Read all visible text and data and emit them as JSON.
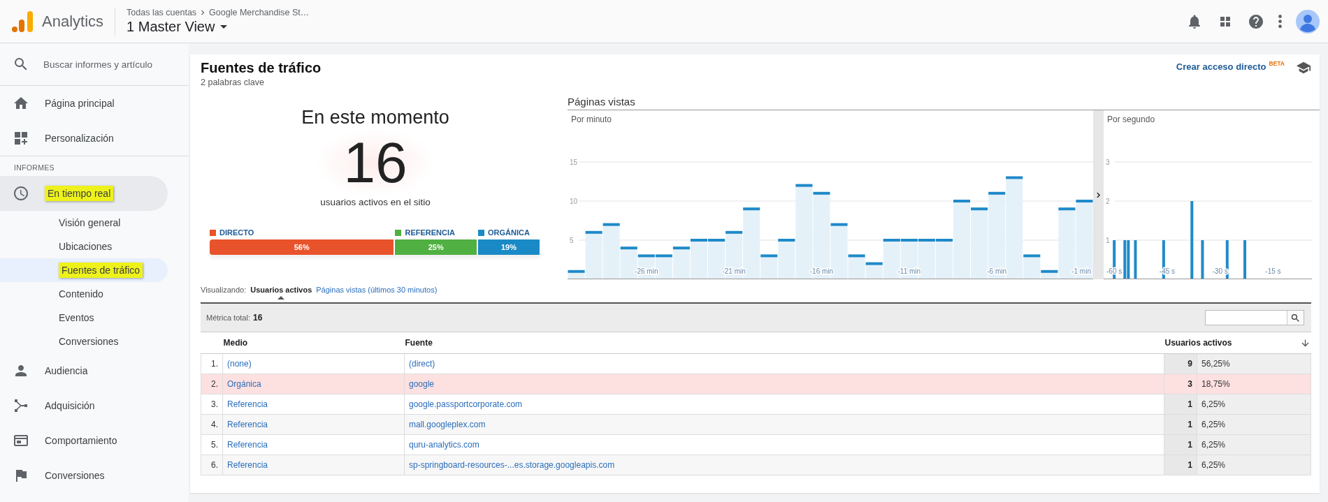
{
  "header": {
    "product": "Analytics",
    "breadcrumb": [
      "Todas las cuentas",
      "Google Merchandise St…"
    ],
    "view": "1 Master View"
  },
  "sidebar": {
    "search_placeholder": "Buscar informes y artículo",
    "nav": [
      {
        "label": "Página principal"
      },
      {
        "label": "Personalización"
      }
    ],
    "section_label": "INFORMES",
    "reports": [
      {
        "label": "En tiempo real",
        "selected": true,
        "highlighted": true,
        "children": [
          {
            "label": "Visión general",
            "selected": false,
            "highlighted": false
          },
          {
            "label": "Ubicaciones",
            "selected": false,
            "highlighted": false
          },
          {
            "label": "Fuentes de tráfico",
            "selected": true,
            "highlighted": true
          },
          {
            "label": "Contenido",
            "selected": false,
            "highlighted": false
          },
          {
            "label": "Eventos",
            "selected": false,
            "highlighted": false
          },
          {
            "label": "Conversiones",
            "selected": false,
            "highlighted": false
          }
        ]
      },
      {
        "label": "Audiencia",
        "selected": false,
        "highlighted": false
      },
      {
        "label": "Adquisición",
        "selected": false,
        "highlighted": false
      },
      {
        "label": "Comportamiento",
        "selected": false,
        "highlighted": false
      },
      {
        "label": "Conversiones",
        "selected": false,
        "highlighted": false
      }
    ]
  },
  "report": {
    "title": "Fuentes de tráfico",
    "subtitle": "2 palabras clave",
    "shortcut_link": "Crear acceso directo",
    "shortcut_badge": "BETA",
    "now": {
      "heading": "En este momento",
      "count": "16",
      "caption": "usuarios activos en el sitio",
      "segments": [
        {
          "label": "DIRECTO",
          "value": "56%",
          "color": "#e9532b"
        },
        {
          "label": "REFERENCIA",
          "value": "25%",
          "color": "#50b041"
        },
        {
          "label": "ORGÁNICA",
          "value": "19%",
          "color": "#1a8ac6"
        }
      ]
    },
    "pageviews": {
      "title": "Páginas vistas",
      "per_minute": {
        "label": "Por minuto",
        "chart_data": {
          "type": "bar",
          "x": [
            -30,
            -29,
            -28,
            -27,
            -26,
            -25,
            -24,
            -23,
            -22,
            -21,
            -20,
            -19,
            -18,
            -17,
            -16,
            -15,
            -14,
            -13,
            -12,
            -11,
            -10,
            -9,
            -8,
            -7,
            -6,
            -5,
            -4,
            -3,
            -2,
            -1
          ],
          "values": [
            1,
            6,
            7,
            4,
            3,
            3,
            4,
            5,
            5,
            6,
            9,
            3,
            5,
            12,
            11,
            7,
            3,
            2,
            5,
            5,
            5,
            5,
            10,
            9,
            11,
            13,
            3,
            1,
            9,
            10
          ],
          "xlim": [
            -30.5,
            -0.5
          ],
          "ylim": [
            0,
            15
          ],
          "grid": true,
          "xticks": [
            {
              "value": -26,
              "label": "-26 min"
            },
            {
              "value": -21,
              "label": "-21 min"
            },
            {
              "value": -16,
              "label": "-16 min"
            },
            {
              "value": -11,
              "label": "-11 min"
            },
            {
              "value": -6,
              "label": "-6 min"
            },
            {
              "value": -1,
              "label": "-1 min"
            }
          ],
          "yticks": [
            5,
            10,
            15
          ]
        }
      },
      "per_second": {
        "label": "Por segundo",
        "chart_data": {
          "type": "bar",
          "x": [
            -60,
            -57,
            -56,
            -54,
            -46,
            -38,
            -35,
            -28,
            -23
          ],
          "values": [
            1,
            1,
            1,
            1,
            1,
            2,
            1,
            1,
            1
          ],
          "xlim": [
            -63,
            -4
          ],
          "ylim": [
            0,
            3
          ],
          "grid": true,
          "xticks": [
            {
              "value": -60,
              "label": "-60 s"
            },
            {
              "value": -45,
              "label": "-45 s"
            },
            {
              "value": -30,
              "label": "-30 s"
            },
            {
              "value": -15,
              "label": "-15 s"
            }
          ],
          "yticks": [
            1,
            2,
            3
          ]
        }
      }
    },
    "view_switch": {
      "label": "Visualizando:",
      "options": [
        {
          "label": "Usuarios activos",
          "selected": true
        },
        {
          "label": "Páginas vistas (últimos 30 minutos)",
          "selected": false
        }
      ]
    },
    "table": {
      "metric_label": "Métrica total:",
      "metric_value": "16",
      "columns": [
        "Medio",
        "Fuente",
        "Usuarios activos"
      ],
      "rows": [
        {
          "index": "1.",
          "medium": "(none)",
          "source": "(direct)",
          "count": "9",
          "share": "56,25%",
          "highlighted": false
        },
        {
          "index": "2.",
          "medium": "Orgánica",
          "source": "google",
          "count": "3",
          "share": "18,75%",
          "highlighted": true
        },
        {
          "index": "3.",
          "medium": "Referencia",
          "source": "google.passportcorporate.com",
          "count": "1",
          "share": "6,25%",
          "highlighted": false
        },
        {
          "index": "4.",
          "medium": "Referencia",
          "source": "mall.googleplex.com",
          "count": "1",
          "share": "6,25%",
          "highlighted": false
        },
        {
          "index": "5.",
          "medium": "Referencia",
          "source": "quru-analytics.com",
          "count": "1",
          "share": "6,25%",
          "highlighted": false
        },
        {
          "index": "6.",
          "medium": "Referencia",
          "source": "sp-springboard-resources-...es.storage.googleapis.com",
          "count": "1",
          "share": "6,25%",
          "highlighted": false
        }
      ]
    }
  }
}
